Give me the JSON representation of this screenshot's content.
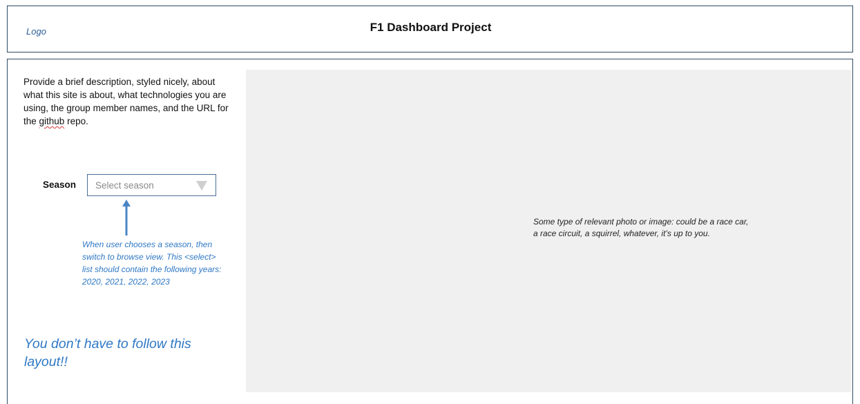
{
  "header": {
    "logo": "Logo",
    "title": "F1 Dashboard Project"
  },
  "sidebar": {
    "description_before": "Provide a brief description, styled nicely, about what this site is about, what technologies you are using, the group member names, and the URL for the ",
    "description_misspelled": "github",
    "description_after": " repo.",
    "season_label": "Season",
    "season_placeholder": "Select season",
    "annotation": "When user chooses a season, then switch to browse view. This <select> list should contain the following years: 2020, 2021, 2022, 2023",
    "layout_note": "You don’t have to follow this layout!!"
  },
  "main": {
    "image_caption": "Some type of relevant photo or image: could be a race car, a race circuit, a squirrel, whatever, it’s up to you."
  },
  "colors": {
    "border": "#2f4a63",
    "annotation_blue": "#2f78c4",
    "placeholder_bg": "#f0f0f0"
  },
  "icons": {
    "dropdown": "dropdown-triangle-icon",
    "annotation_arrow": "up-arrow-icon"
  }
}
